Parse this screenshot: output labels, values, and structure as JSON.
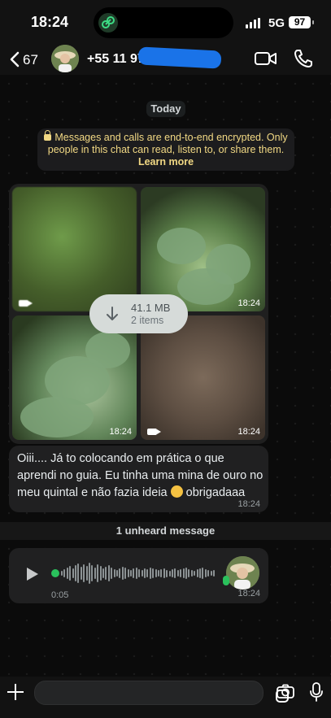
{
  "status": {
    "time": "18:24",
    "network": "5G",
    "battery": "97"
  },
  "header": {
    "back_count": "67",
    "contact": "+55 11 9700"
  },
  "chat": {
    "day": "Today",
    "encryption_notice": "Messages and calls are end-to-end encrypted. Only people in this chat can read, listen to, or share them.",
    "learn_more": "Learn more",
    "album": {
      "times": [
        "18:24",
        "18:24",
        "18:24"
      ],
      "download_size": "41.1 MB",
      "download_items": "2 items"
    },
    "message": {
      "text_a": "Oiii.... Já to colocando em prática o que aprendi no guia. Eu tinha uma mina de ouro no meu quintal e não fazia ideia",
      "text_b": "obrigadaaa",
      "time": "18:24"
    },
    "unread_divider": "1 unheard message",
    "voice": {
      "duration": "0:05",
      "time": "18:24"
    }
  },
  "icons": {
    "back": "chevron-left-icon",
    "video": "video-camera-icon",
    "call": "phone-icon",
    "download": "arrow-down-icon",
    "play": "play-icon",
    "plus": "plus-icon",
    "sticker": "sticker-icon",
    "camera": "camera-icon",
    "mic": "microphone-icon"
  },
  "colors": {
    "accent_green": "#2ac15c",
    "encryption_text": "#f2d984"
  }
}
